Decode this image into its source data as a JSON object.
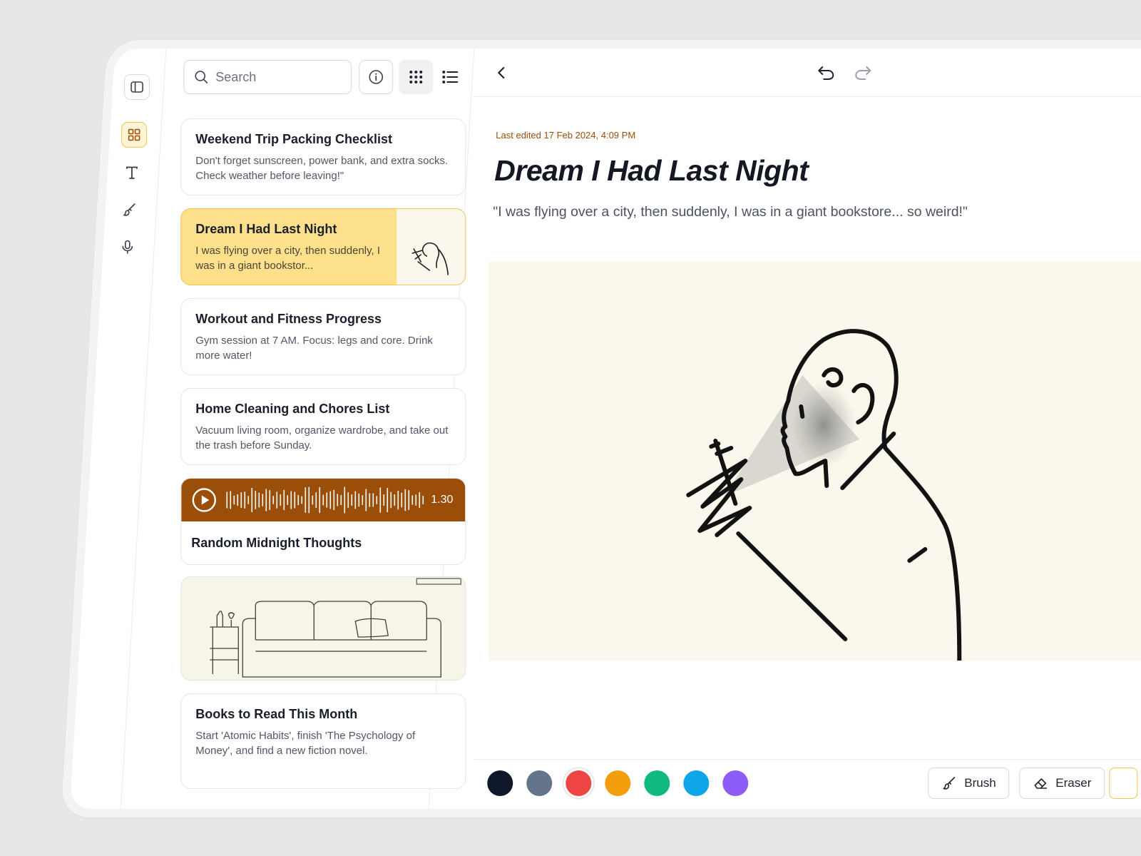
{
  "search": {
    "placeholder": "Search"
  },
  "notes": [
    {
      "title": "Weekend Trip Packing Checklist",
      "body": "Don't forget sunscreen, power bank, and extra socks. Check weather before leaving!\""
    },
    {
      "title": "Dream I Had Last Night",
      "body": "I was flying over a city, then suddenly, I was in a giant bookstor...",
      "selected": true
    },
    {
      "title": "Workout and Fitness Progress",
      "body": "Gym session at 7 AM. Focus: legs and core. Drink more water!"
    },
    {
      "title": "Home Cleaning and Chores List",
      "body": "Vacuum living room, organize wardrobe, and take out the trash before Sunday."
    },
    {
      "title": "Random Midnight Thoughts",
      "audio_duration": "1.30"
    },
    {
      "title": "Books to Read This Month",
      "body": "Start 'Atomic Habits', finish 'The Psychology of Money', and find a new fiction novel."
    }
  ],
  "editor": {
    "last_edited": "Last edited 17 Feb 2024, 4:09 PM",
    "title": "Dream I Had Last Night",
    "quote": "\"I was flying over a city, then suddenly, I was in a giant bookstore... so weird!\""
  },
  "palette": {
    "colors": [
      "#0f172a",
      "#64748b",
      "#ef4444",
      "#f59e0b",
      "#10b981",
      "#0ea5e9",
      "#8b5cf6"
    ],
    "selected_index": 2
  },
  "tools": {
    "brush_label": "Brush",
    "eraser_label": "Eraser"
  },
  "theme": {
    "accent": "#fde08b",
    "accent_border": "#f2c44b",
    "audio": "#9a4e08"
  }
}
